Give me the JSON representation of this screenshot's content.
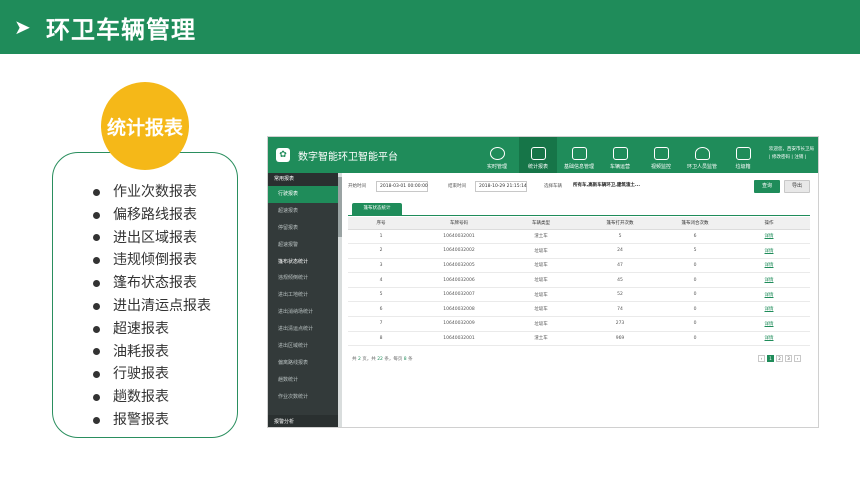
{
  "slide": {
    "title": "环卫车辆管理",
    "badge": "统计报表",
    "report_list": [
      "作业次数报表",
      "偏移路线报表",
      "进出区域报表",
      "违规倾倒报表",
      "篷布状态报表",
      "进出清运点报表",
      "超速报表",
      "油耗报表",
      "行驶报表",
      "趟数报表",
      "报警报表"
    ]
  },
  "app": {
    "name": "数字智能环卫智能平台",
    "nav": [
      {
        "label": "实时管理"
      },
      {
        "label": "统计报表"
      },
      {
        "label": "基础信息管理"
      },
      {
        "label": "车辆运营"
      },
      {
        "label": "视频监控"
      },
      {
        "label": "环卫人员监管"
      },
      {
        "label": "垃圾箱"
      }
    ],
    "user_line1": "欢迎您，西安市长卫局",
    "user_line2": "| 修改密码 | 注销 |",
    "sidebar": {
      "section": "常用报表",
      "items": [
        "行驶报表",
        "超速报表",
        "停留报表",
        "超速报警",
        "篷布状态统计",
        "违规倾倒统计",
        "进出工地统计",
        "进出消纳场统计",
        "进出清运点统计",
        "进出区域统计",
        "偏离路线报表",
        "趟数统计",
        "作业次数统计"
      ],
      "bottom": "报警分析"
    },
    "filters": {
      "start_label": "开始时间",
      "start_value": "2018-03-01 00:00:00",
      "end_label": "结束时间",
      "end_value": "2018-10-29 21:15:14",
      "plate_label": "选择车辆",
      "plate_value": "所有车,高新车辆环卫,建筑渣土..."
    },
    "query_button": "查询",
    "export_button": "导出",
    "tab": "篷布状态统计",
    "table": {
      "headers": [
        "序号",
        "车牌号码",
        "车辆类型",
        "篷布打开次数",
        "篷布闭合次数",
        "操作"
      ],
      "rows": [
        [
          "1",
          "10640032001",
          "渣土车",
          "5",
          "6",
          "详情"
        ],
        [
          "2",
          "10640032002",
          "垃圾车",
          "24",
          "5",
          "详情"
        ],
        [
          "3",
          "10640032005",
          "垃圾车",
          "47",
          "0",
          "详情"
        ],
        [
          "4",
          "10640032006",
          "垃圾车",
          "45",
          "0",
          "详情"
        ],
        [
          "5",
          "10640032007",
          "垃圾车",
          "52",
          "0",
          "详情"
        ],
        [
          "6",
          "10640032008",
          "垃圾车",
          "74",
          "0",
          "详情"
        ],
        [
          "7",
          "10640032009",
          "垃圾车",
          "273",
          "0",
          "详情"
        ],
        [
          "8",
          "10640032001",
          "渣土车",
          "969",
          "0",
          "详情"
        ]
      ]
    },
    "pager_info": {
      "p1": "共",
      "pages": "2",
      "p2": "页，共",
      "total": "22",
      "p3": "条，每页",
      "per": "8",
      "p4": "条"
    },
    "pager": [
      "‹",
      "1",
      "2",
      "3",
      "›"
    ]
  }
}
